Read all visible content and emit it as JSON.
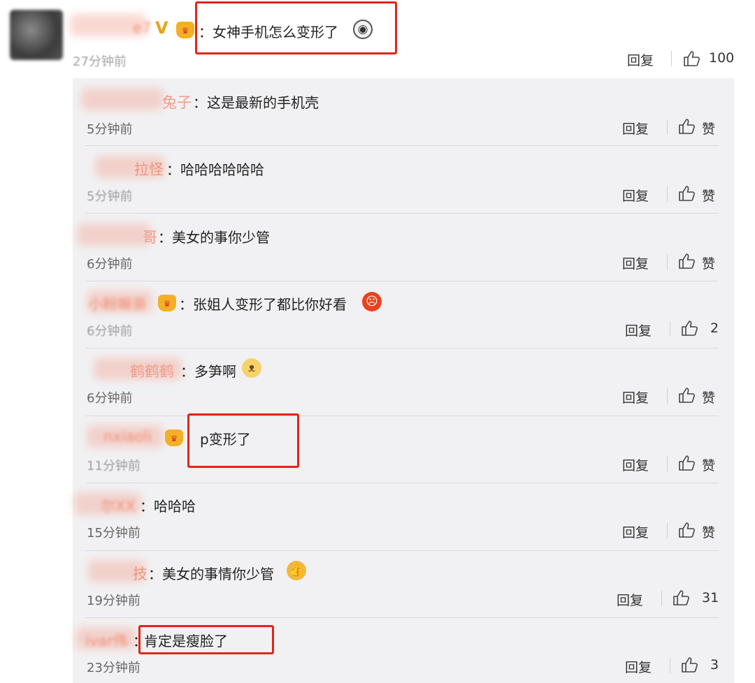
{
  "main_comment": {
    "name": "e7",
    "badges": [
      "verified-v",
      "vip-crown"
    ],
    "text": "：女神手机怎么变形了",
    "emoji": "surprised-face-emoji",
    "time": "27分钟前",
    "reply_label": "回复",
    "like_label": "100"
  },
  "replies": [
    {
      "name": "兔子",
      "text": "：这是最新的手机壳",
      "emoji": "",
      "time": "5分钟前",
      "reply_label": "回复",
      "like_label": "赞"
    },
    {
      "name": "拉怪",
      "text": "：哈哈哈哈哈哈",
      "emoji": "",
      "time": "5分钟前",
      "reply_label": "回复",
      "like_label": "赞"
    },
    {
      "name": "哥",
      "text": "：美女的事你少管",
      "emoji": "",
      "time": "6分钟前",
      "reply_label": "回复",
      "like_label": "赞"
    },
    {
      "name": "小粉嘛亲",
      "text": "：张姐人变形了都比你好看",
      "emoji": "angry-face-emoji",
      "time": "6分钟前",
      "reply_label": "回复",
      "like_label": "2"
    },
    {
      "name": "鹤鹤鹤",
      "text": "：多笋啊",
      "emoji": "dog-face-emoji",
      "time": "6分钟前",
      "reply_label": "回复",
      "like_label": "赞"
    },
    {
      "name": "nxiaoli",
      "text": "p变形了",
      "emoji": "",
      "time": "11分钟前",
      "reply_label": "回复",
      "like_label": "赞"
    },
    {
      "name": "尔XX",
      "text": "：哈哈哈",
      "emoji": "",
      "time": "15分钟前",
      "reply_label": "回复",
      "like_label": "赞"
    },
    {
      "name": "技",
      "text": "：美女的事情你少管",
      "emoji": "thumbs-up-emoji",
      "time": "19分钟前",
      "reply_label": "回复",
      "like_label": "31"
    },
    {
      "name": "ivar伟",
      "text": "肯定是瘦脸了",
      "emoji": "",
      "time": "23分钟前",
      "reply_label": "回复",
      "like_label": "3"
    }
  ],
  "colors": {
    "highlight_box": "#e1251b",
    "username": "#f07a5a",
    "panel_bg": "#f1f1f3"
  }
}
